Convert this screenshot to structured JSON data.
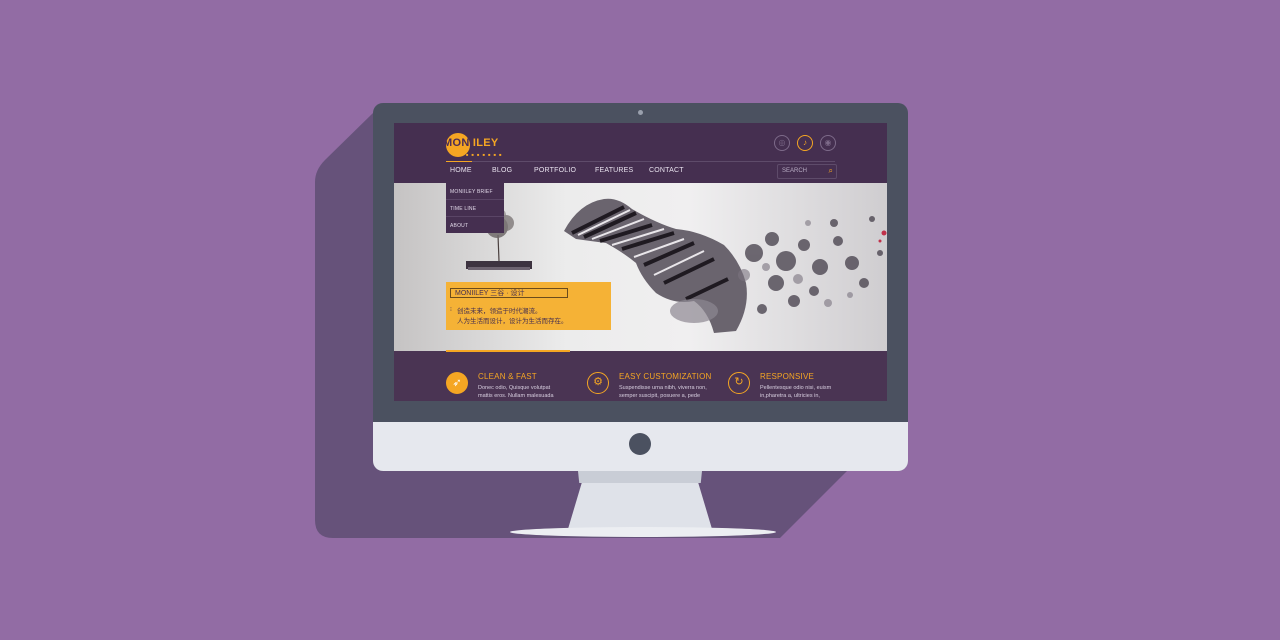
{
  "site": {
    "logo": {
      "text_highlight": "MONI",
      "text_rest": "ILEY",
      "dots": "■ ■ ■ ■ ■ ■ ■"
    },
    "social_icons": [
      {
        "name": "weibo-icon",
        "glyph": "◎",
        "active": false
      },
      {
        "name": "bell-icon",
        "glyph": "♪",
        "active": true
      },
      {
        "name": "wechat-icon",
        "glyph": "◉",
        "active": false
      }
    ],
    "nav": {
      "items": [
        "HOME",
        "BLOG",
        "PORTFOLIO",
        "FEATURES",
        "CONTACT"
      ],
      "active": "HOME"
    },
    "search": {
      "placeholder": "SEARCH",
      "icon": "search-icon"
    },
    "dropdown": {
      "items": [
        "MONIILEY BRIEF",
        "TIME LINE",
        "ABOUT"
      ]
    },
    "tagline": {
      "title": "MONIILEY 三谷 · 设计",
      "line1": "创造未来，领造于时代潮流。",
      "line2": "人为生活而设计，设计为生活而存在。"
    },
    "features": [
      {
        "title": "CLEAN & FAST",
        "icon": "rocket-icon",
        "body1": "Donec odio, Quisque volutpat",
        "body2": "mattis eros. Nullam malesuada"
      },
      {
        "title": "EASY CUSTOMIZATION",
        "icon": "gear-icon",
        "body1": "Suspendisse urna nibh, viverra non,",
        "body2": "semper suscipit, posuere a, pede"
      },
      {
        "title": "RESPONSIVE",
        "icon": "refresh-icon",
        "body1": "Pellentesque odio nisi, euism",
        "body2": "in,pharetra a, ultricies in,"
      }
    ]
  },
  "colors": {
    "background": "#926ca4",
    "accent": "#f5a623",
    "site_dark": "#452f50",
    "monitor_frame": "#4b5160",
    "monitor_chin": "#e6e8ee"
  }
}
